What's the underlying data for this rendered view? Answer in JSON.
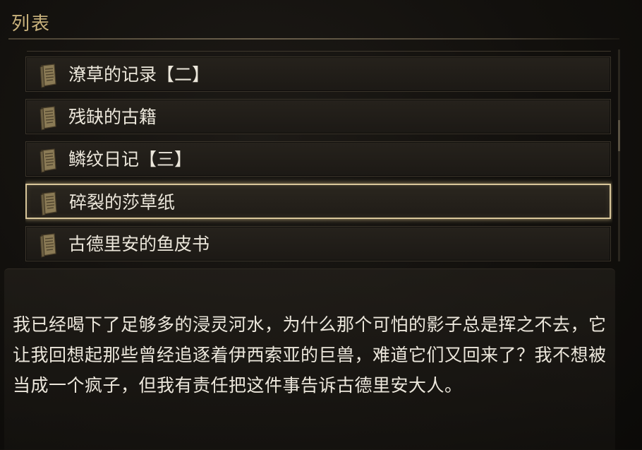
{
  "panel": {
    "title": "列表"
  },
  "list": {
    "items": [
      {
        "label": "潦草的记录【二】",
        "icon": "scroll-icon",
        "selected": false
      },
      {
        "label": "残缺的古籍",
        "icon": "scroll-icon",
        "selected": false
      },
      {
        "label": "鳞纹日记【三】",
        "icon": "scroll-icon",
        "selected": false
      },
      {
        "label": "碎裂的莎草纸",
        "icon": "scroll-icon",
        "selected": true
      },
      {
        "label": "古德里安的鱼皮书",
        "icon": "scroll-icon",
        "selected": false
      }
    ]
  },
  "description": {
    "text": "我已经喝下了足够多的浸灵河水，为什么那个可怕的影子总是挥之不去，它让我回想起那些曾经追逐着伊西索亚的巨兽，难道它们又回来了？我不想被当成一个疯子，但我有责任把这件事告诉古德里安大人。"
  },
  "colors": {
    "accent_title": "#c9b27c",
    "selected_border": "#d8c69a",
    "item_bg": "#26221c"
  }
}
